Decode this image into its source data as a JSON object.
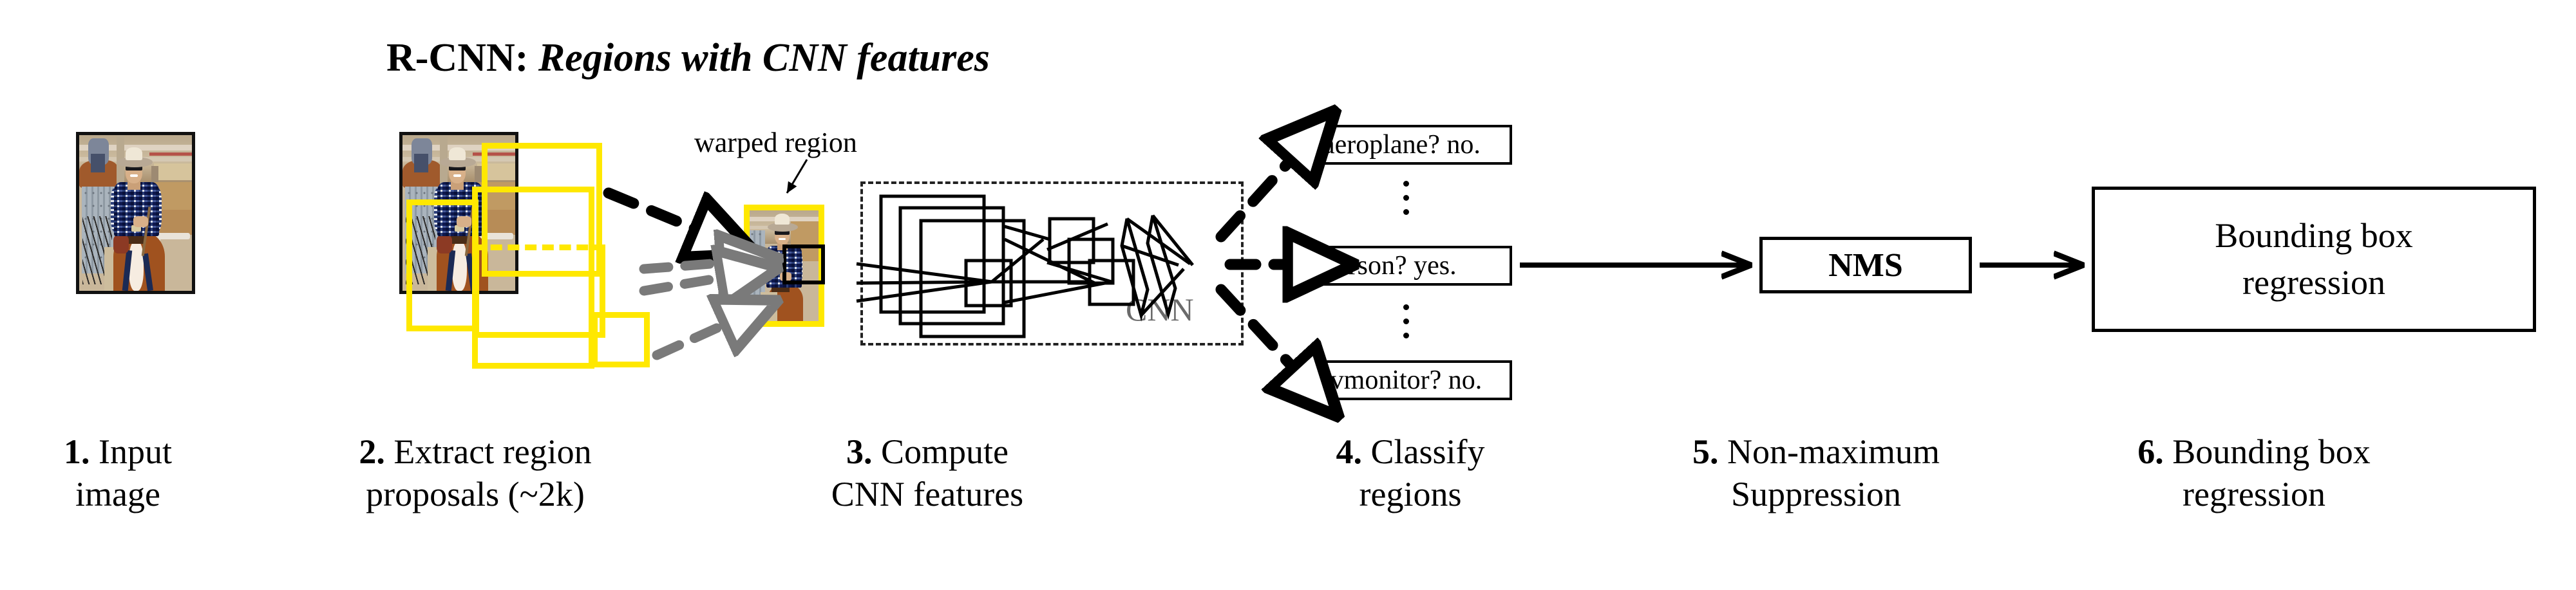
{
  "title": {
    "prefix": "R-CNN: ",
    "emphasis": "Regions with CNN features"
  },
  "labels": {
    "warped_region": "warped region",
    "cnn": "CNN"
  },
  "classifications": [
    {
      "name": "aeroplane-result",
      "text": "aeroplane? no."
    },
    {
      "name": "person-result",
      "text": "person? yes."
    },
    {
      "name": "tvmonitor-result",
      "text": "tvmonitor? no."
    }
  ],
  "nms": {
    "label": "NMS"
  },
  "bbox_regression": {
    "line1": "Bounding box",
    "line2": "regression"
  },
  "steps": [
    {
      "num": "1.",
      "line1": " Input",
      "line2": "image"
    },
    {
      "num": "2.",
      "line1": " Extract region",
      "line2": "proposals (~2k)"
    },
    {
      "num": "3.",
      "line1": " Compute",
      "line2": "CNN features"
    },
    {
      "num": "4.",
      "line1": " Classify",
      "line2": "regions"
    },
    {
      "num": "5.",
      "line1": " Non-maximum",
      "line2": "Suppression"
    },
    {
      "num": "6.",
      "line1": " Bounding box",
      "line2": "regression"
    }
  ],
  "colors": {
    "proposal_box": "#FFE800",
    "outline": "#000000",
    "cnn_label": "#6a6a6a",
    "gray_arrow": "#7a7a7a",
    "photo_border": "#111111"
  },
  "photo_caption": "person riding a horse at a rodeo arena"
}
